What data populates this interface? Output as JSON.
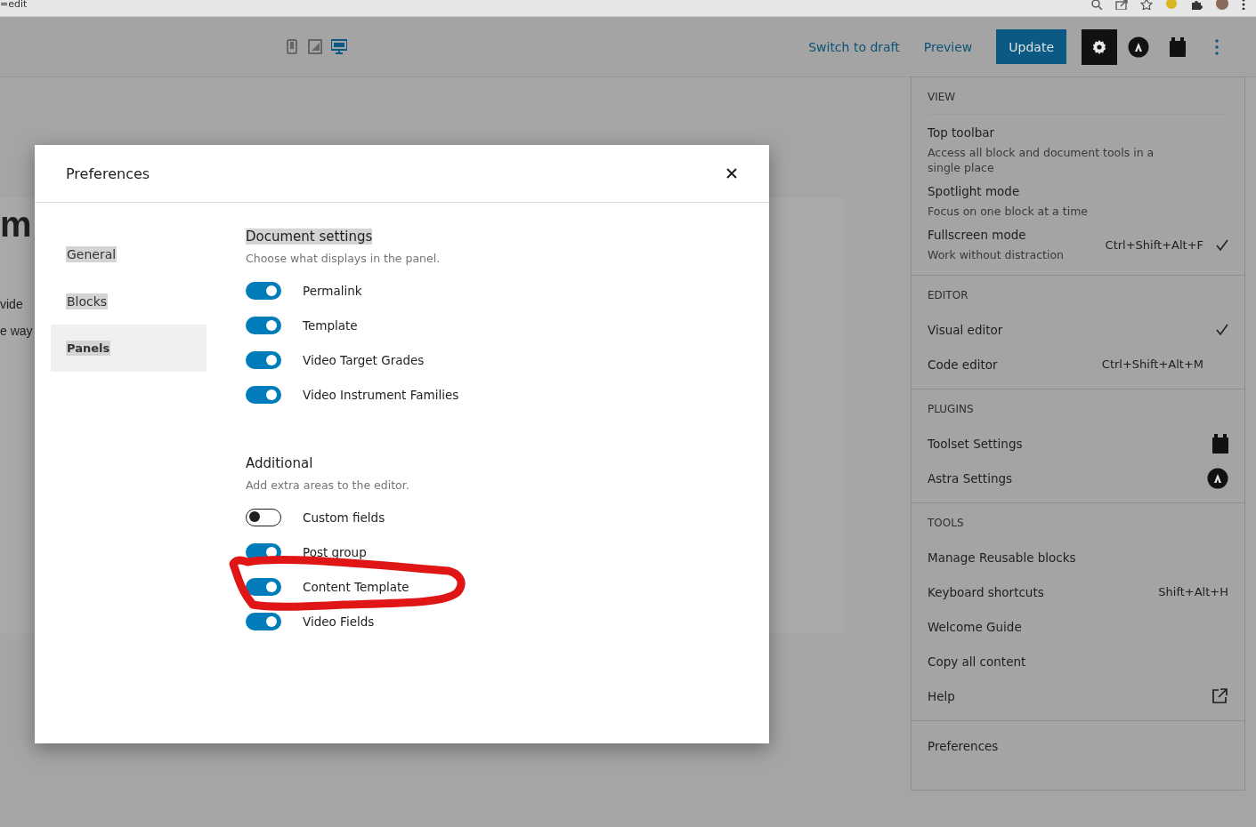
{
  "browser": {
    "address_fragment": "=edit"
  },
  "toolbar": {
    "devices": [
      {
        "kind": "mobile",
        "selected": false
      },
      {
        "kind": "tablet",
        "selected": false
      },
      {
        "kind": "desktop",
        "selected": true
      }
    ],
    "links": [
      "Switch to draft",
      "Preview"
    ],
    "update_button": "Update",
    "settings_selected": true
  },
  "background_text": [
    "m",
    "vide",
    "e way"
  ],
  "dialog": {
    "title": "Preferences",
    "nav": [
      {
        "label": "General",
        "selected": false
      },
      {
        "label": "Blocks",
        "selected": false
      },
      {
        "label": "Panels",
        "selected": true
      }
    ],
    "sections": [
      {
        "title": "Document settings",
        "highlighted": true,
        "description": "Choose what displays in the panel.",
        "toggles": [
          {
            "label": "Permalink",
            "on": true
          },
          {
            "label": "Template",
            "on": true
          },
          {
            "label": "Video Target Grades",
            "on": true
          },
          {
            "label": "Video Instrument Families",
            "on": true
          }
        ]
      },
      {
        "title": "Additional",
        "highlighted": false,
        "description": "Add extra areas to the editor.",
        "toggles": [
          {
            "label": "Custom fields",
            "on": false
          },
          {
            "label": "Post group",
            "on": true
          },
          {
            "label": "Content Template",
            "on": true
          },
          {
            "label": "Video Fields",
            "on": true
          }
        ]
      }
    ]
  },
  "menu": {
    "groups": [
      {
        "heading": "VIEW",
        "items": [
          {
            "kind": "option",
            "label": "Top toolbar",
            "description": "Access all block and document tools in a single place",
            "checked": false
          },
          {
            "kind": "option",
            "label": "Spotlight mode",
            "description": "Focus on one block at a time",
            "checked": false
          },
          {
            "kind": "option",
            "label": "Fullscreen mode",
            "description": "Work without distraction",
            "shortcut": "Ctrl+Shift+Alt+F",
            "checked": true
          }
        ]
      },
      {
        "heading": "EDITOR",
        "items": [
          {
            "kind": "option",
            "label": "Visual editor",
            "checked": true
          },
          {
            "kind": "option",
            "label": "Code editor",
            "shortcut": "Ctrl+Shift+Alt+M",
            "checked": false
          }
        ]
      },
      {
        "heading": "PLUGINS",
        "items": [
          {
            "kind": "plugin",
            "label": "Toolset Settings"
          },
          {
            "kind": "plugin",
            "label": "Astra Settings"
          }
        ]
      },
      {
        "heading": "TOOLS",
        "items": [
          {
            "kind": "plain",
            "label": "Manage Reusable blocks"
          },
          {
            "kind": "plain",
            "label": "Keyboard shortcuts",
            "shortcut": "Shift+Alt+H"
          },
          {
            "kind": "plain",
            "label": "Welcome Guide"
          },
          {
            "kind": "plain",
            "label": "Copy all content"
          },
          {
            "kind": "external",
            "label": "Help"
          }
        ]
      },
      {
        "items": [
          {
            "kind": "plain",
            "label": "Preferences"
          }
        ]
      }
    ]
  }
}
